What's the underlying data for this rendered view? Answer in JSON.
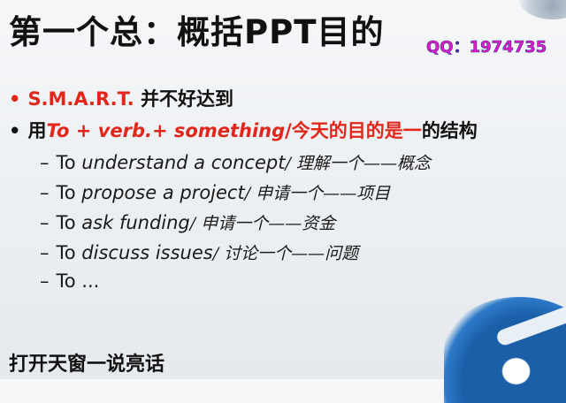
{
  "slide": {
    "title": "第一个总：概括PPT目的",
    "watermark": "QQ：1974735",
    "accent_color": "#e3261b",
    "bullets": [
      {
        "bullet": "•",
        "text_red": "S.M.A.R.T.",
        "text_black": " 并不好达到"
      },
      {
        "bullet": "•",
        "prefix": "用",
        "formula": "To + verb.+ something",
        "formula_suffix": "/今天的目的是一",
        "suffix": "的结构"
      }
    ],
    "sub_items": [
      {
        "dash": "–",
        "to": "To ",
        "phrase": "understand a concept",
        "zh": "/ 理解一个——概念"
      },
      {
        "dash": "–",
        "to": "To ",
        "phrase": "propose a project",
        "zh": "/ 申请一个——项目"
      },
      {
        "dash": "–",
        "to": "To ",
        "phrase": "ask funding",
        "zh": "/ 申请一个——资金"
      },
      {
        "dash": "–",
        "to": "To ",
        "phrase": "discuss issues",
        "zh": "/ 讨论一个——问题"
      },
      {
        "dash": "–",
        "to": "To ",
        "phrase": "...",
        "zh": ""
      }
    ],
    "footer": "打开天窗一说亮话"
  }
}
